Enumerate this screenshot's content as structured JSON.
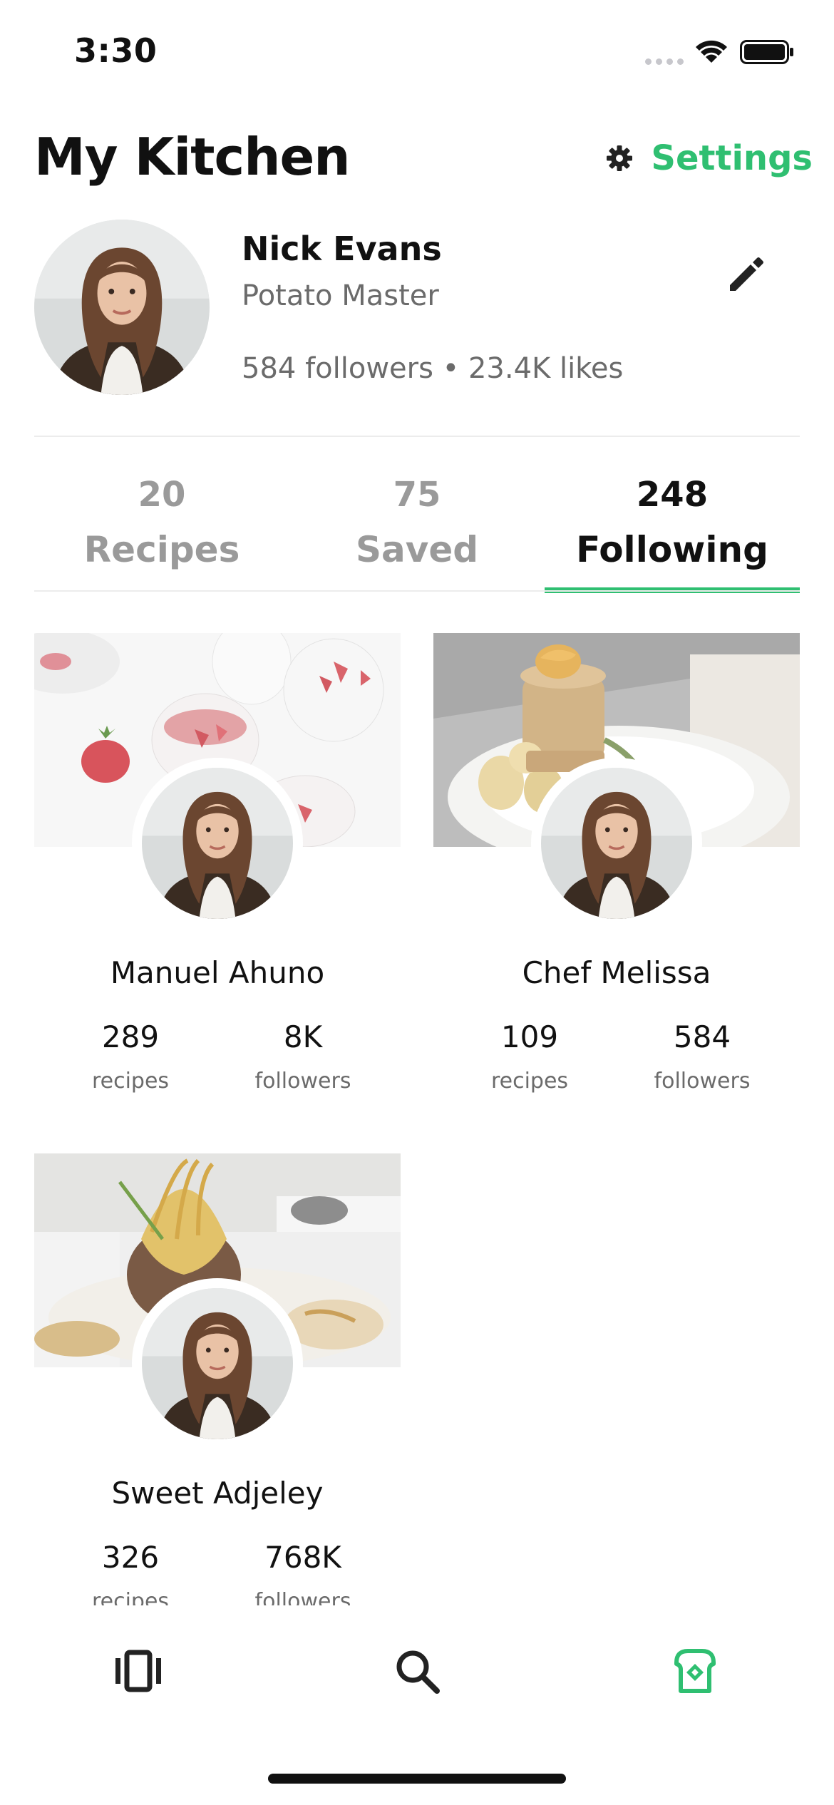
{
  "status_bar": {
    "time": "3:30",
    "icons": [
      "signal-dots-icon",
      "wifi-icon",
      "battery-icon"
    ]
  },
  "header": {
    "title": "My Kitchen",
    "settings_label": "Settings",
    "settings_icon": "gear-icon"
  },
  "profile": {
    "name": "Nick Evans",
    "subtitle": "Potato Master",
    "stats": "584 followers • 23.4K likes",
    "edit_icon": "pencil-icon"
  },
  "tabs": [
    {
      "count": "20",
      "label": "Recipes",
      "active": false
    },
    {
      "count": "75",
      "label": "Saved",
      "active": false
    },
    {
      "count": "248",
      "label": "Following",
      "active": true
    }
  ],
  "following": [
    {
      "name": "Manuel Ahuno",
      "recipes": "289",
      "recipes_label": "recipes",
      "followers": "8K",
      "followers_label": "followers"
    },
    {
      "name": "Chef Melissa",
      "recipes": "109",
      "recipes_label": "recipes",
      "followers": "584",
      "followers_label": "followers"
    },
    {
      "name": "Sweet Adjeley",
      "recipes": "326",
      "recipes_label": "recipes",
      "followers": "768K",
      "followers_label": "followers"
    }
  ],
  "bottom_nav": [
    {
      "icon": "feed-cards-icon",
      "active": false
    },
    {
      "icon": "search-icon",
      "active": false
    },
    {
      "icon": "kitchen-icon",
      "active": true
    }
  ],
  "colors": {
    "accent": "#2fbf71",
    "text": "#111111",
    "muted": "#6b6b6b",
    "inactive_tab": "#9a9a9a"
  }
}
